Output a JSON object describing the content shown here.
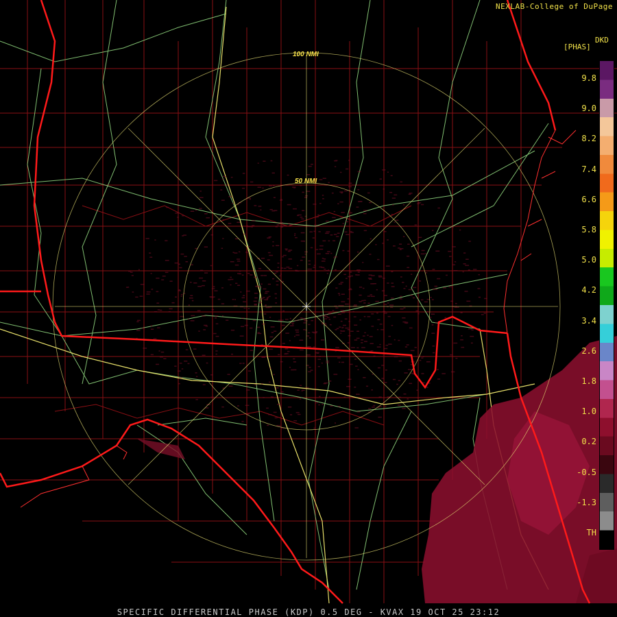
{
  "credit": "NEXLAB-College of DuPage",
  "legend": {
    "units_line1": "DKD",
    "units_line2": "[PHAS]",
    "labels": [
      "9.8",
      "9.0",
      "8.2",
      "7.4",
      "6.6",
      "5.8",
      "5.0",
      "4.2",
      "3.4",
      "2.6",
      "1.8",
      "1.0",
      "0.2",
      "-0.5",
      "-1.3",
      "TH"
    ],
    "colors": [
      "#5b1763",
      "#7a2c80",
      "#c99aa8",
      "#f4c79a",
      "#f4ae70",
      "#f08a3c",
      "#f06a1c",
      "#f59a18",
      "#f5d40c",
      "#f0f200",
      "#c6ec00",
      "#19c71f",
      "#0fa81a",
      "#7ed2cf",
      "#35cfd9",
      "#6a86c9",
      "#c986c6",
      "#c3508f",
      "#b0264e",
      "#8e0f2d",
      "#6a0a1f",
      "#3a060f",
      "#2a2a2a",
      "#5e5e5e",
      "#8c8c8c",
      "#000000"
    ]
  },
  "rings": {
    "inner": "50 NMI",
    "outer": "100 NMI"
  },
  "caption": "SPECIFIC DIFFERENTIAL PHASE (KDP) 0.5 DEG - KVAX 19 OCT 25 23:12",
  "colors": {
    "background": "#000000",
    "county": "#8a0f14",
    "state": "#ff1a1a",
    "highway": "#8fd47e",
    "interstate": "#e8e06a",
    "ring": "#e0d870",
    "echo": "#7a0f28"
  }
}
